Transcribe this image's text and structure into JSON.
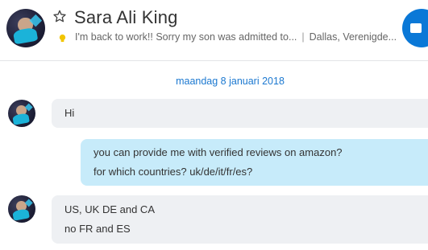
{
  "contact": {
    "name": "Sara Ali King",
    "mood_message": "I'm back to work!! Sorry my son was admitted to...",
    "location": "Dallas, Verenigde..."
  },
  "date_divider": "maandag 8 januari 2018",
  "messages": [
    {
      "direction": "incoming",
      "lines": [
        "Hi"
      ]
    },
    {
      "direction": "outgoing",
      "lines": [
        "you can provide me with verified reviews on amazon?",
        "for which countries? uk/de/it/fr/es?"
      ]
    },
    {
      "direction": "incoming",
      "lines": [
        "US, UK DE and CA",
        "no FR and ES"
      ]
    }
  ],
  "icons": {
    "favorite": "star-outline-icon",
    "mood": "lightbulb-icon",
    "call": "video-call-icon"
  },
  "colors": {
    "accent": "#0a78d7",
    "date": "#1b78d0",
    "incoming_bubble": "#eef0f3",
    "outgoing_bubble": "#c7ebfa",
    "mood_bulb": "#f2c500"
  }
}
